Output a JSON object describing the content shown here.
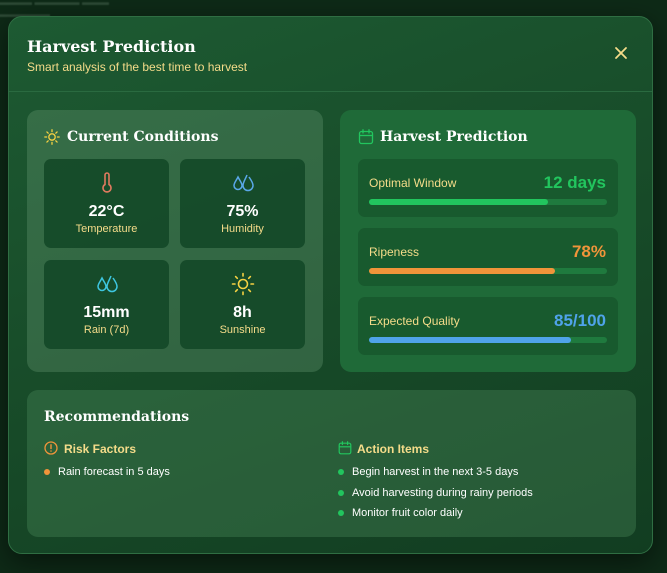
{
  "modal": {
    "title": "Harvest Prediction",
    "subtitle": "Smart analysis of the best time to harvest",
    "close_icon": "close-icon"
  },
  "conditions": {
    "title": "Current Conditions",
    "icon": "sun-icon",
    "stats": [
      {
        "value": "22°C",
        "label": "Temperature",
        "icon": "thermometer-icon",
        "color": "#e07a5f"
      },
      {
        "value": "75%",
        "label": "Humidity",
        "icon": "droplets-icon",
        "color": "#5aa8e8"
      },
      {
        "value": "15mm",
        "label": "Rain (7d)",
        "icon": "droplets-icon",
        "color": "#3ec6e0"
      },
      {
        "value": "8h",
        "label": "Sunshine",
        "icon": "sun-icon",
        "color": "#f5d142"
      }
    ]
  },
  "prediction": {
    "title": "Harvest Prediction",
    "icon": "calendar-icon",
    "metrics": [
      {
        "label": "Optimal Window",
        "value": "12 days",
        "progress": 0.75,
        "color": "#22c55e"
      },
      {
        "label": "Ripeness",
        "value": "78%",
        "progress": 0.78,
        "color": "#f0943a"
      },
      {
        "label": "Expected Quality",
        "value": "85/100",
        "progress": 0.85,
        "color": "#4fa3ea"
      }
    ]
  },
  "recommendations": {
    "title": "Recommendations",
    "risk": {
      "title": "Risk Factors",
      "icon": "alert-circle-icon",
      "color": "#f0943a",
      "items": [
        "Rain forecast in 5 days"
      ]
    },
    "actions": {
      "title": "Action Items",
      "icon": "calendar-icon",
      "color": "#22c55e",
      "items": [
        "Begin harvest in the next 3-5 days",
        "Avoid harvesting during rainy periods",
        "Monitor fruit color daily"
      ]
    }
  }
}
